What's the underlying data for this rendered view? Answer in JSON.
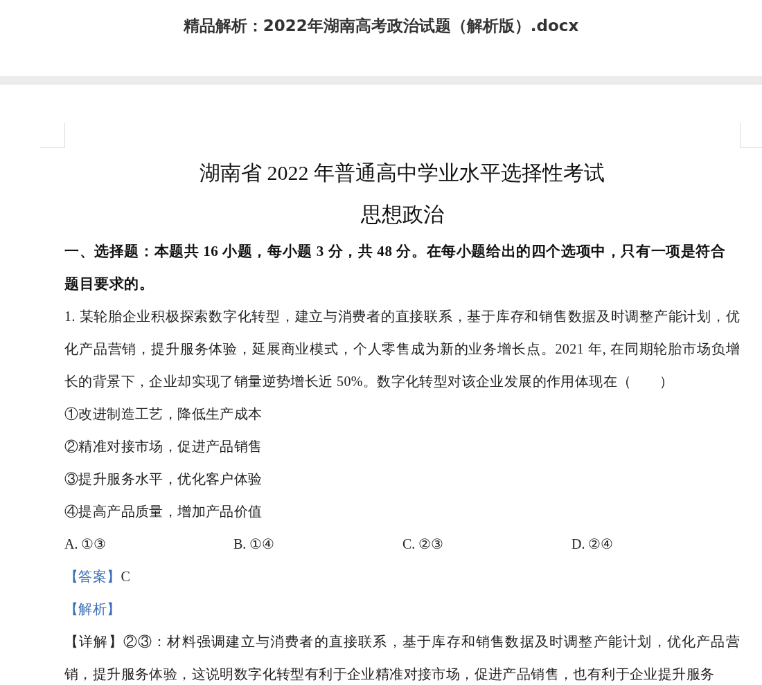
{
  "window": {
    "title": "精品解析：2022年湖南高考政治试题（解析版）.docx"
  },
  "document": {
    "title": "湖南省 2022 年普通高中学业水平选择性考试",
    "subtitle": "思想政治",
    "section_heading": "一、选择题：本题共 16 小题，每小题 3 分，共 48 分。在每小题给出的四个选项中，只有一项是符合题目要求的。",
    "blocks": [
      {
        "kind": "question",
        "text": "1. 某轮胎企业积极探索数字化转型，建立与消费者的直接联系，基于库存和销售数据及时调整产能计划，优化产品营销，提升服务体验，延展商业模式，个人零售成为新的业务增长点。2021 年, 在同期轮胎市场负增长的背景下，企业却实现了销量逆势增长近 50%。数字化转型对该企业发展的作用体现在（　　）"
      },
      {
        "kind": "option",
        "text": "①改进制造工艺，降低生产成本"
      },
      {
        "kind": "option",
        "text": "②精准对接市场，促进产品销售"
      },
      {
        "kind": "option",
        "text": "③提升服务水平，优化客户体验"
      },
      {
        "kind": "option",
        "text": "④提高产品质量，增加产品价值"
      },
      {
        "kind": "choices",
        "items": [
          "A. ①③",
          "B. ①④",
          "C. ②③",
          "D. ②④"
        ]
      },
      {
        "kind": "answer",
        "label": "【答案】",
        "text": "C"
      },
      {
        "kind": "analysis",
        "label": "【解析】"
      },
      {
        "kind": "detail",
        "label": "【详解】",
        "text": "②③：材料强调建立与消费者的直接联系，基于库存和销售数据及时调整产能计划，优化产品营销，提升服务体验，这说明数字化转型有利于企业精准对接市场，促进产品销售，也有利于企业提升服务"
      }
    ]
  }
}
